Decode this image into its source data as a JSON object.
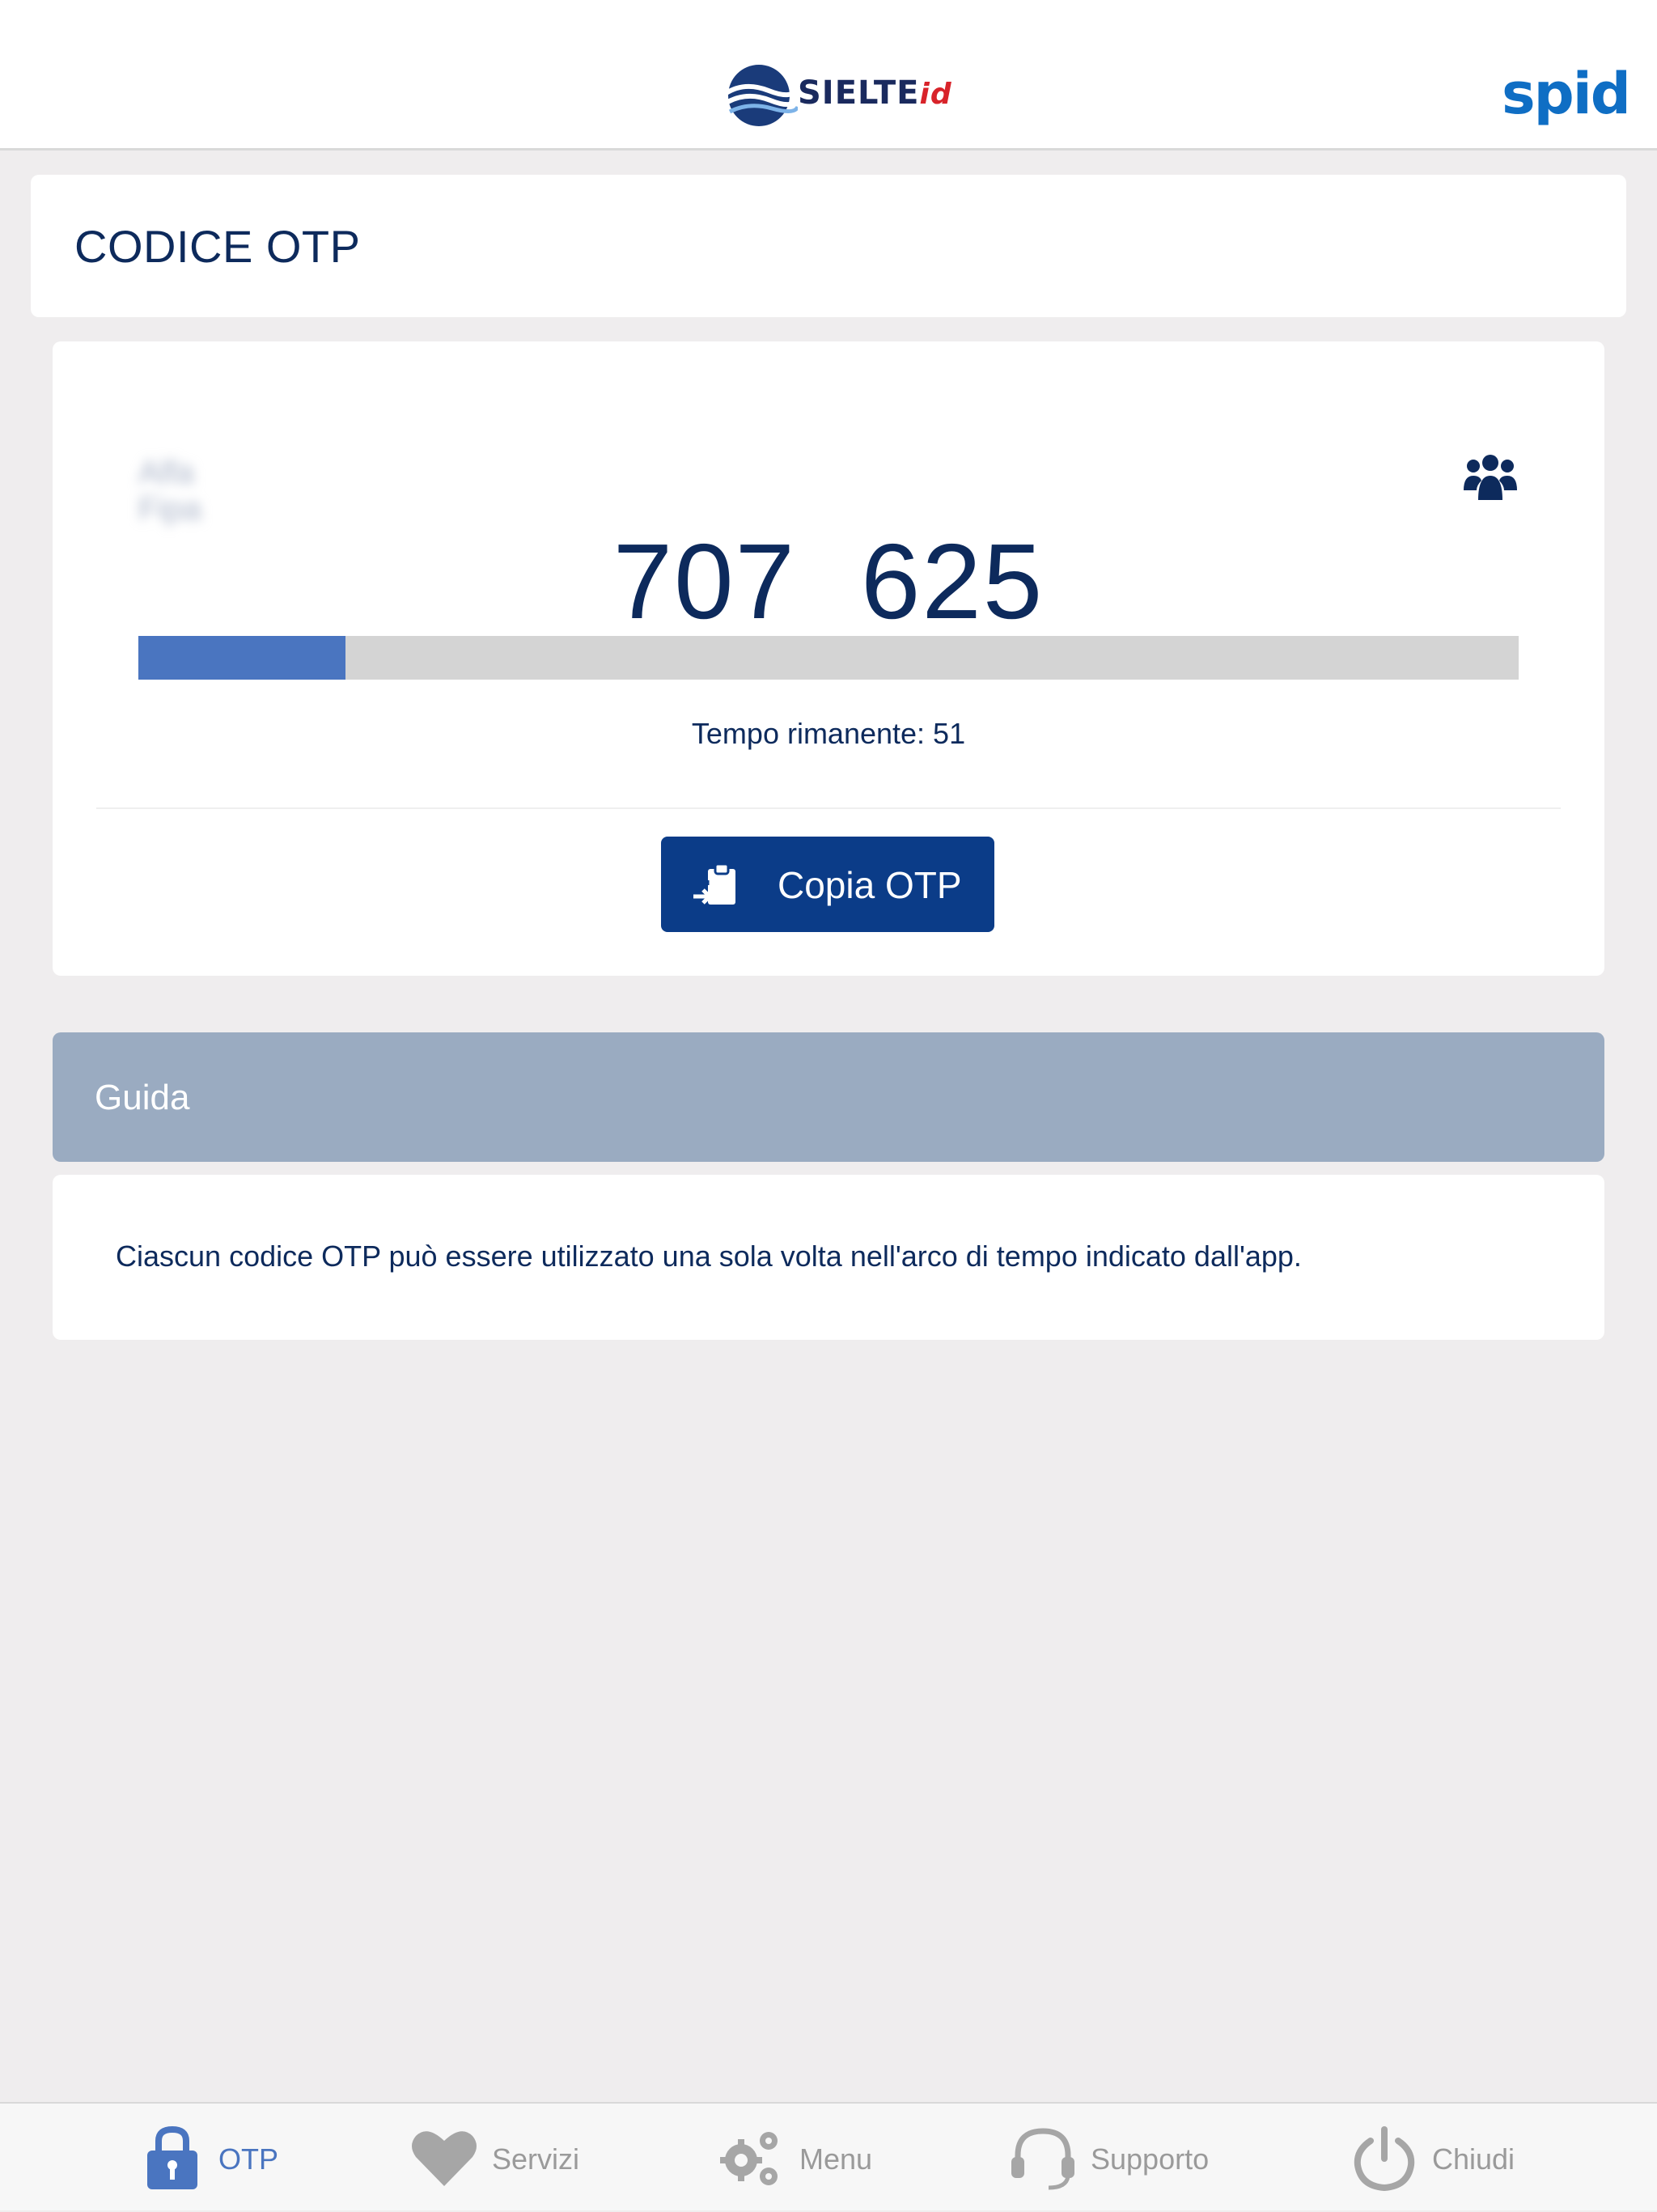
{
  "header": {
    "brand": "SIELTE",
    "brand_suffix": "id",
    "spid_logo": "spid"
  },
  "title_card": {
    "title": "CODICE OTP"
  },
  "otp": {
    "account_name": "Alfa Fipa",
    "code_part1": "707",
    "code_part2": "625",
    "remaining_label": "Tempo rimanente: 51",
    "progress_fraction": 0.15,
    "copy_button": "Copia OTP",
    "accounts_icon": "users-icon"
  },
  "guide": {
    "title": "Guida",
    "text": "Ciascun codice OTP può essere utilizzato una sola volta nell'arco di tempo indicato dall'app."
  },
  "tabs": [
    {
      "label": "OTP",
      "icon": "lock-icon",
      "active": true
    },
    {
      "label": "Servizi",
      "icon": "heart-icon",
      "active": false
    },
    {
      "label": "Menu",
      "icon": "gears-icon",
      "active": false
    },
    {
      "label": "Supporto",
      "icon": "headset-icon",
      "active": false
    },
    {
      "label": "Chiudi",
      "icon": "power-icon",
      "active": false
    }
  ],
  "colors": {
    "primary": "#0b3c88",
    "text_dark": "#0d2a5c",
    "accent": "#4a75c0",
    "guide_header": "#9aabc1",
    "background": "#efedee"
  }
}
